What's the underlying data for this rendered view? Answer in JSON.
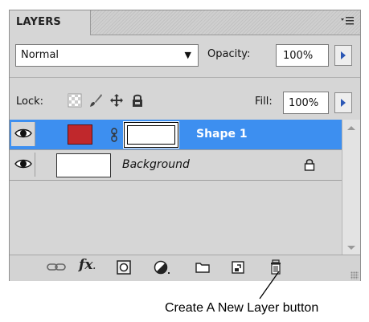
{
  "panel": {
    "tab_label": "LAYERS",
    "menu_icon": "panel-menu-icon",
    "blend_mode": "Normal",
    "opacity_label": "Opacity:",
    "opacity_value": "100%",
    "lock_label": "Lock:",
    "fill_label": "Fill:",
    "fill_value": "100%"
  },
  "lock_icons": [
    "lock-transparent-icon",
    "lock-image-brush-icon",
    "lock-position-move-icon",
    "lock-all-icon"
  ],
  "layers": [
    {
      "name": "Shape 1",
      "selected": true,
      "thumb_color": "#c0282c",
      "mask_color": "#ffffff"
    },
    {
      "name": "Background",
      "selected": false,
      "thumb_color": "#ffffff",
      "locked": true
    }
  ],
  "toolbar_icons": [
    "link-layers-icon",
    "fx-icon",
    "add-mask-icon",
    "adjustment-layer-icon",
    "group-folder-icon",
    "new-layer-icon",
    "trash-icon"
  ],
  "toolbar": {
    "fx_label": "fx"
  },
  "colors": {
    "selection": "#3d8ff0",
    "panel": "#d6d6d6",
    "stepper_arrow": "#2b57b5"
  },
  "caption": "Create A New Layer button"
}
